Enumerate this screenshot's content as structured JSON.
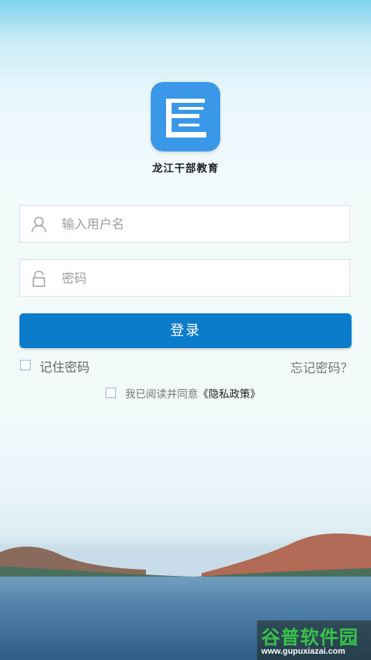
{
  "app": {
    "name": "龙江干部教育"
  },
  "login_form": {
    "username_placeholder": "输入用户名",
    "password_placeholder": "密码",
    "login_button": "登录",
    "remember_label": "记住密码",
    "forgot_link": "忘记密码？",
    "agree_prefix": "我已阅读并同意",
    "policy_link": "《隐私政策》"
  },
  "watermark": {
    "title": "谷普软件园",
    "url": "www.gupuxiazai.com"
  },
  "colors": {
    "primary_button": "#0a7cc9",
    "logo_bg": "#3b97e8",
    "checkbox_border": "#7fb7df"
  },
  "icons": {
    "username": "user-icon",
    "password": "lock-icon"
  }
}
